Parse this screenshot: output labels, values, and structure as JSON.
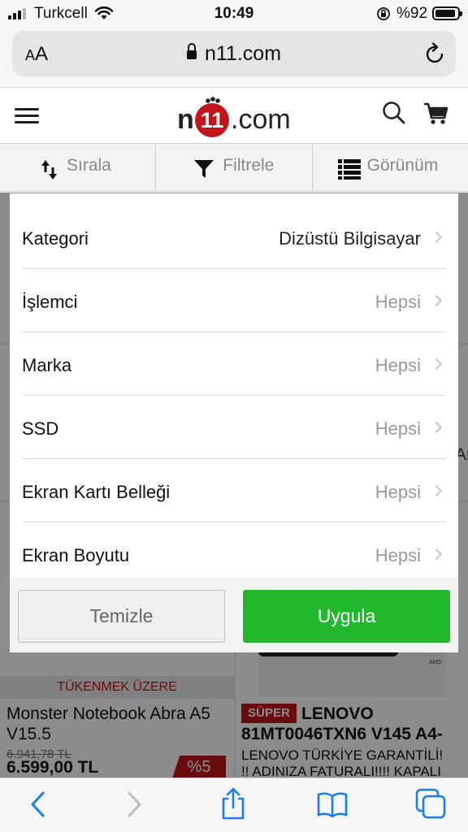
{
  "status_bar": {
    "carrier": "Turkcell",
    "time": "10:49",
    "battery": "%92"
  },
  "browser": {
    "text_size_label_small": "A",
    "text_size_label_big": "A",
    "url": "n11.com"
  },
  "site": {
    "logo": {
      "n": "n",
      "eleven": "11",
      "domain": ".com"
    },
    "toolbar": {
      "sort": "Sırala",
      "filter": "Filtrele",
      "view": "Görünüm"
    }
  },
  "filter_modal": {
    "rows": [
      {
        "label": "Kategori",
        "value": "Dizüstü Bilgisayar"
      },
      {
        "label": "İşlemci",
        "value": "Hepsi"
      },
      {
        "label": "Marka",
        "value": "Hepsi"
      },
      {
        "label": "SSD",
        "value": "Hepsi"
      },
      {
        "label": "Ekran Kartı Belleği",
        "value": "Hepsi"
      },
      {
        "label": "Ekran Boyutu",
        "value": "Hepsi"
      }
    ],
    "clear_label": "Temizle",
    "apply_label": "Uygula"
  },
  "background": {
    "left_product": {
      "badge": "TÜKENMEK ÜZERE",
      "title": "Monster Notebook Abra A5 V15.5",
      "old_price": "6.941,78 TL",
      "price": "6.599,00 TL",
      "discount": "%5"
    },
    "right_product": {
      "badge": "SÜPER",
      "title": "LENOVO 81MT0046TXN6 V145 A4-",
      "desc_line1": "LENOVO TÜRKİYE GARANTİLİ!",
      "desc_line2": "!! ADINIZA FATURALI!!!! KAPALI",
      "brand": "AMD"
    },
    "edge_text": "Ar"
  },
  "colors": {
    "brand_red": "#c0161b",
    "apply_green": "#22b82d",
    "ios_blue": "#1a7cf5"
  }
}
